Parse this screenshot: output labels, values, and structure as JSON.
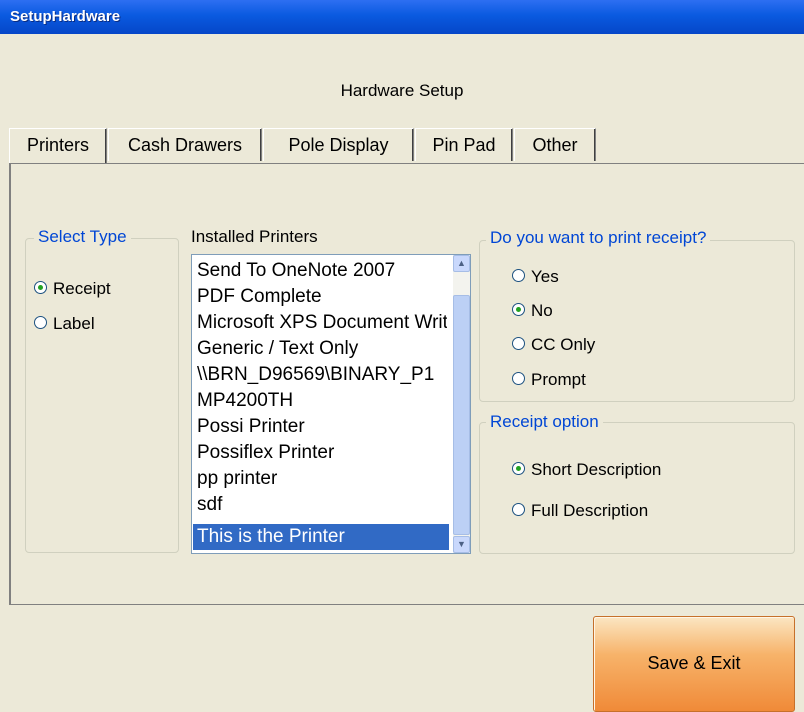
{
  "window": {
    "title": "SetupHardware"
  },
  "heading": "Hardware Setup",
  "tabs": [
    "Printers",
    "Cash Drawers",
    "Pole Display",
    "Pin Pad",
    "Other"
  ],
  "select_type": {
    "title": "Select Type",
    "options": [
      "Receipt",
      "Label"
    ],
    "selected": "Receipt"
  },
  "installed_printers": {
    "title": "Installed Printers",
    "items": [
      "Send To OneNote 2007",
      "PDF Complete",
      "Microsoft XPS Document Writer",
      "Generic / Text Only",
      "\\\\BRN_D96569\\BINARY_P1",
      "MP4200TH",
      "Possi Printer",
      "Possiflex Printer",
      "pp printer",
      "sdf",
      "This is the Printer"
    ],
    "selected": "This is the Printer"
  },
  "print_receipt": {
    "title": "Do you want to print receipt?",
    "options": [
      "Yes",
      "No",
      "CC Only",
      "Prompt"
    ],
    "selected": "No"
  },
  "receipt_option": {
    "title": "Receipt option",
    "options": [
      "Short Description",
      "Full Description"
    ],
    "selected": "Short Description"
  },
  "save_button": "Save & Exit",
  "colors": {
    "titlebar": "#0a5ae0",
    "group_title": "#0046d5",
    "selection": "#316ac5",
    "save_button": "#f08a38"
  }
}
